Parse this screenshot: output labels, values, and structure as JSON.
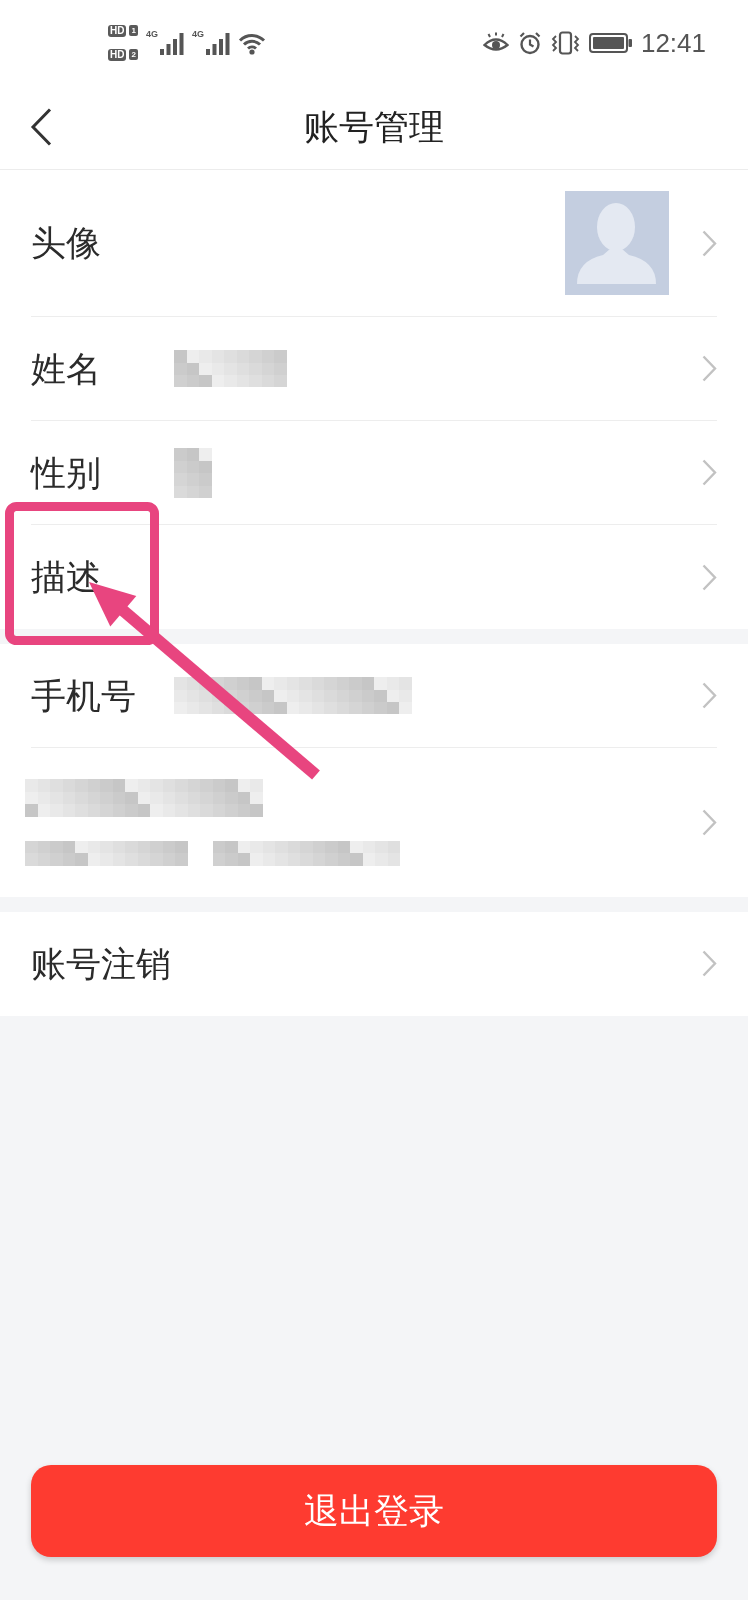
{
  "status_bar": {
    "sims": [
      {
        "badge": "HD",
        "slot": "1",
        "network": "4G"
      },
      {
        "badge": "HD",
        "slot": "2",
        "network": "4G"
      }
    ],
    "time": "12:41"
  },
  "header": {
    "title": "账号管理"
  },
  "sections": [
    {
      "rows": [
        {
          "kind": "avatar",
          "label": "头像",
          "redacted": false,
          "highlighted": false
        },
        {
          "kind": "field",
          "label": "姓名",
          "redacted": true,
          "highlighted": false
        },
        {
          "kind": "field",
          "label": "性别",
          "redacted": true,
          "highlighted": false
        },
        {
          "kind": "field",
          "label": "描述",
          "redacted": false,
          "highlighted": true
        }
      ]
    },
    {
      "rows": [
        {
          "kind": "field",
          "label": "手机号",
          "redacted": true,
          "highlighted": false
        },
        {
          "kind": "field",
          "redacted": true,
          "highlighted": false
        }
      ]
    },
    {
      "rows": [
        {
          "kind": "field",
          "label": "账号注销",
          "redacted": false,
          "highlighted": false
        }
      ]
    }
  ],
  "logout_button": {
    "label": "退出登录"
  }
}
